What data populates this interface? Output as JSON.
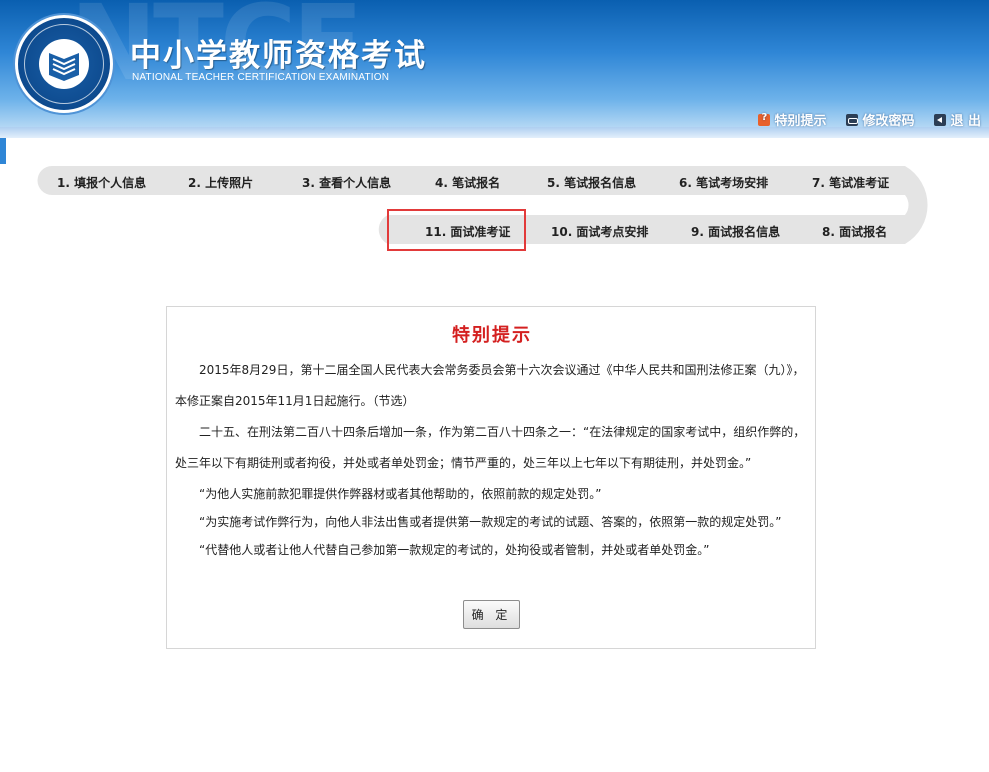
{
  "header": {
    "watermark": "NTCE",
    "title_cn": "中小学教师资格考试",
    "title_en": "NATIONAL TEACHER CERTIFICATION EXAMINATION",
    "logo_text": "教师资格考试 · National Teacher Certification Examination",
    "links": [
      {
        "label": "特别提示",
        "icon": "help-icon"
      },
      {
        "label": "修改密码",
        "icon": "key-icon"
      },
      {
        "label": "退 出",
        "icon": "exit-icon"
      }
    ]
  },
  "steps": {
    "row1": [
      "1. 填报个人信息",
      "2. 上传照片",
      "3. 查看个人信息",
      "4. 笔试报名",
      "5. 笔试报名信息",
      "6. 笔试考场安排",
      "7. 笔试准考证"
    ],
    "row2": [
      "11. 面试准考证",
      "10. 面试考点安排",
      "9. 面试报名信息",
      "8. 面试报名"
    ],
    "active": "11. 面试准考证",
    "track_color": "#e4e4e4",
    "active_border_color": "#e23a3a"
  },
  "notice": {
    "title": "特别提示",
    "paragraphs": [
      "2015年8月29日，第十二届全国人民代表大会常务委员会第十六次会议通过《中华人民共和国刑法修正案（九）》，本修正案自2015年11月1日起施行。（节选）",
      "二十五、在刑法第二百八十四条后增加一条，作为第二百八十四条之一：“在法律规定的国家考试中，组织作弊的，处三年以下有期徒刑或者拘役，并处或者单处罚金；情节严重的，处三年以上七年以下有期徒刑，并处罚金。”",
      "“为他人实施前款犯罪提供作弊器材或者其他帮助的，依照前款的规定处罚。”",
      "“为实施考试作弊行为，向他人非法出售或者提供第一款规定的考试的试题、答案的，依照第一款的规定处罚。”",
      "“代替他人或者让他人代替自己参加第一款规定的考试的，处拘役或者管制，并处或者单处罚金。”"
    ],
    "confirm_label": "确 定",
    "title_color": "#d42020"
  }
}
